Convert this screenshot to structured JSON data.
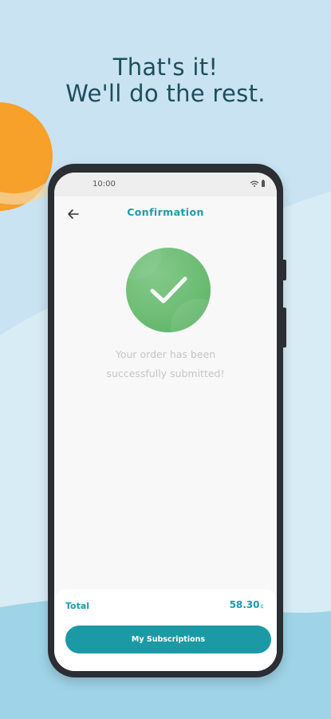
{
  "promo": {
    "headline_line1": "That's it!",
    "headline_line2": "We'll do the rest."
  },
  "colors": {
    "background": "#c9e3f2",
    "accent": "#1e9aa7",
    "success": "#6bbc73",
    "sun": "#f7a02a"
  },
  "status_bar": {
    "time": "10:00",
    "icons": [
      "wifi-icon",
      "battery-icon"
    ]
  },
  "app_bar": {
    "back_icon": "arrow-left-icon",
    "title": "Confirmation"
  },
  "confirmation": {
    "icon": "checkmark-icon",
    "message_line1": "Your order has been",
    "message_line2": "successfully submitted!"
  },
  "footer": {
    "total_label": "Total",
    "total_value": "58.30",
    "currency": "¢",
    "button_label": "My Subscriptions"
  }
}
